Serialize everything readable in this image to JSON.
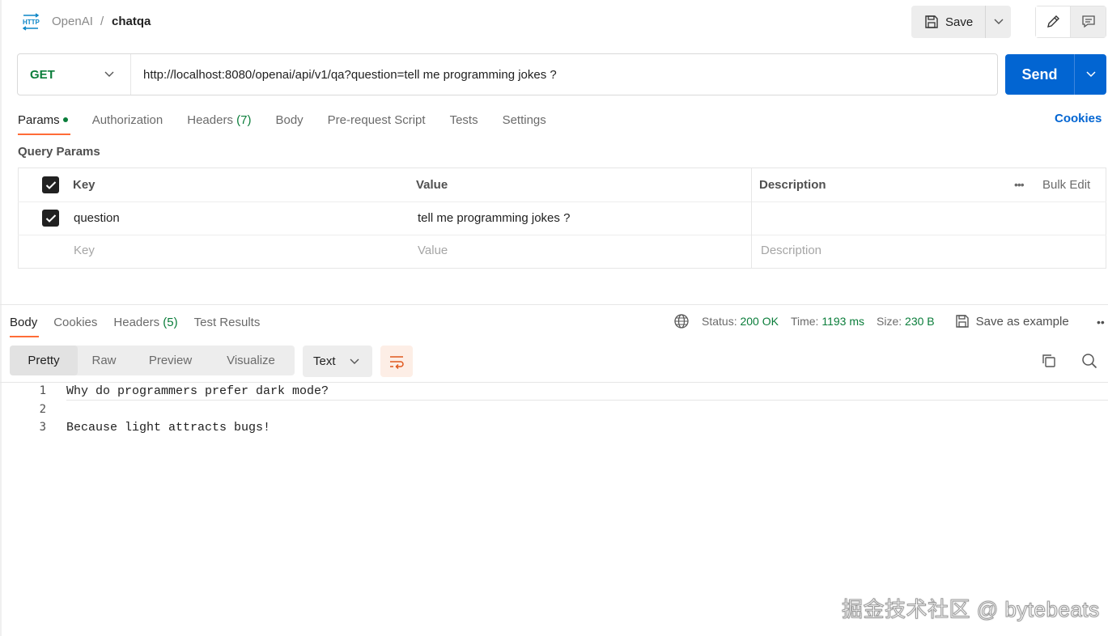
{
  "header": {
    "breadcrumb_parent": "OpenAI",
    "breadcrumb_separator": "/",
    "request_name": "chatqa",
    "save_label": "Save",
    "icons": [
      "http-icon",
      "save-icon",
      "chevron-down-icon",
      "pencil-icon",
      "comment-icon"
    ]
  },
  "request": {
    "method": "GET",
    "url": "http://localhost:8080/openai/api/v1/qa?question=tell me programming jokes ?",
    "send_label": "Send"
  },
  "request_tabs": {
    "params": "Params",
    "authorization": "Authorization",
    "headers": "Headers",
    "headers_count": "(7)",
    "body": "Body",
    "pre_request": "Pre-request Script",
    "tests": "Tests",
    "settings": "Settings",
    "cookies": "Cookies",
    "active": "Params"
  },
  "query_params": {
    "title": "Query Params",
    "columns": {
      "key": "Key",
      "value": "Value",
      "description": "Description"
    },
    "bulk_edit": "Bulk Edit",
    "rows": [
      {
        "checked": true,
        "key": "question",
        "value": "tell me programming jokes ?",
        "description": ""
      }
    ],
    "placeholder": {
      "key": "Key",
      "value": "Value",
      "description": "Description"
    }
  },
  "response_tabs": {
    "body": "Body",
    "cookies": "Cookies",
    "headers": "Headers",
    "headers_count": "(5)",
    "test_results": "Test Results",
    "active": "Body"
  },
  "status": {
    "status_label": "Status:",
    "status_value": "200 OK",
    "time_label": "Time:",
    "time_value": "1193 ms",
    "size_label": "Size:",
    "size_value": "230 B",
    "save_example": "Save as example",
    "more": "••"
  },
  "response_view": {
    "modes": [
      "Pretty",
      "Raw",
      "Preview",
      "Visualize"
    ],
    "active_mode": "Pretty",
    "format": "Text"
  },
  "response_body": {
    "line_numbers": [
      "1",
      "2",
      "3"
    ],
    "lines": [
      "Why do programmers prefer dark mode?",
      "",
      "Because light attracts bugs!"
    ]
  },
  "watermark": "掘金技术社区 @ bytebeats",
  "colors": {
    "accent_orange": "#ff6c37",
    "send_blue": "#0265d2",
    "method_green": "#0a7d3a",
    "status_green": "#0a7d3a"
  }
}
